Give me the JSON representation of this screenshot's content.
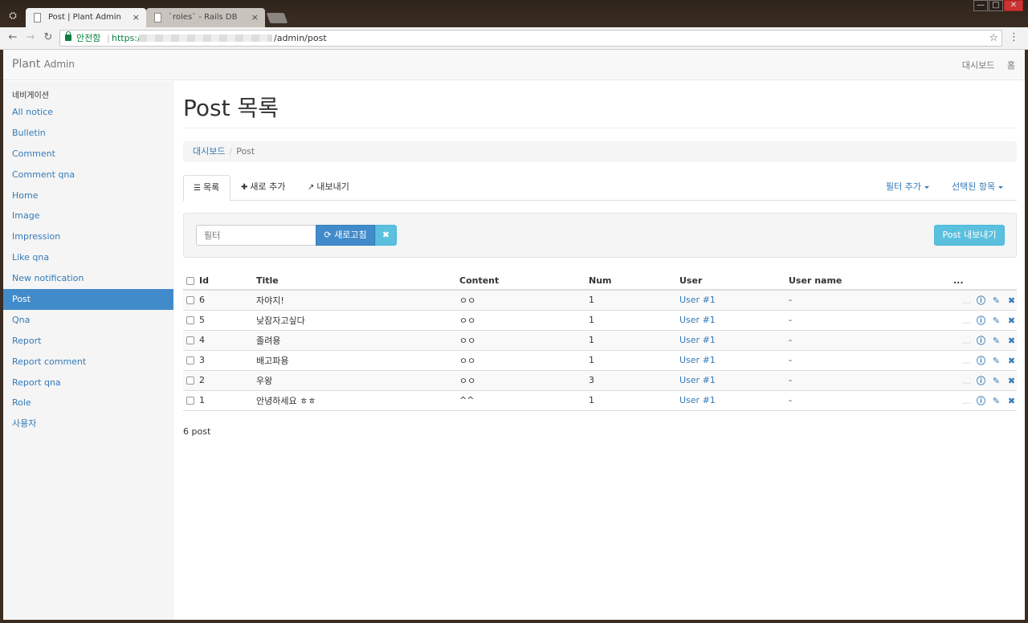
{
  "browser": {
    "tabs": [
      {
        "title": "Post | Plant Admin",
        "close": "×"
      },
      {
        "title": "`roles` - Rails DB",
        "close": "×"
      }
    ],
    "secure_label": "안전함",
    "url_scheme": "https://",
    "url_path": "/admin/post",
    "window_controls": [
      "—",
      "□",
      "✕"
    ]
  },
  "navbar": {
    "brand": "Plant",
    "brand_sub": "Admin",
    "links": [
      "대시보드",
      "홈"
    ]
  },
  "sidebar": {
    "header": "네비게이션",
    "items": [
      {
        "label": "All notice",
        "active": false
      },
      {
        "label": "Bulletin",
        "active": false
      },
      {
        "label": "Comment",
        "active": false
      },
      {
        "label": "Comment qna",
        "active": false
      },
      {
        "label": "Home",
        "active": false
      },
      {
        "label": "Image",
        "active": false
      },
      {
        "label": "Impression",
        "active": false
      },
      {
        "label": "Like qna",
        "active": false
      },
      {
        "label": "New notification",
        "active": false
      },
      {
        "label": "Post",
        "active": true
      },
      {
        "label": "Qna",
        "active": false
      },
      {
        "label": "Report",
        "active": false
      },
      {
        "label": "Report comment",
        "active": false
      },
      {
        "label": "Report qna",
        "active": false
      },
      {
        "label": "Role",
        "active": false
      },
      {
        "label": "사용자",
        "active": false
      }
    ]
  },
  "main": {
    "title": "Post 목록",
    "breadcrumb": {
      "root": "대시보드",
      "current": "Post"
    },
    "tabs": {
      "list": "목록",
      "add_new": "새로 추가",
      "export": "내보내기"
    },
    "tab_right": {
      "add_filter": "필터 추가",
      "selected_items": "선택된 항목"
    },
    "filter": {
      "placeholder": "필터",
      "refresh": "새로고침",
      "export_button": "Post 내보내기"
    },
    "table": {
      "headers": [
        "Id",
        "Title",
        "Content",
        "Num",
        "User",
        "User name",
        "..."
      ],
      "rows": [
        {
          "id": "6",
          "title": "자야지!",
          "content": "ㅇㅇ",
          "num": "1",
          "user": "User #1",
          "user_name": "-",
          "more": "..."
        },
        {
          "id": "5",
          "title": "낮잠자고싶다",
          "content": "ㅇㅇ",
          "num": "1",
          "user": "User #1",
          "user_name": "-",
          "more": "..."
        },
        {
          "id": "4",
          "title": "졸려용",
          "content": "ㅇㅇ",
          "num": "1",
          "user": "User #1",
          "user_name": "-",
          "more": "..."
        },
        {
          "id": "3",
          "title": "배고파용",
          "content": "ㅇㅇ",
          "num": "1",
          "user": "User #1",
          "user_name": "-",
          "more": "..."
        },
        {
          "id": "2",
          "title": "우왕",
          "content": "ㅇㅇ",
          "num": "3",
          "user": "User #1",
          "user_name": "-",
          "more": "..."
        },
        {
          "id": "1",
          "title": "안녕하세요 ㅎㅎ",
          "content": "^^",
          "num": "1",
          "user": "User #1",
          "user_name": "-",
          "more": "..."
        }
      ]
    },
    "count_label": "6 post"
  },
  "colors": {
    "primary": "#428bca",
    "info": "#5bc0de",
    "link": "#337ab7"
  }
}
